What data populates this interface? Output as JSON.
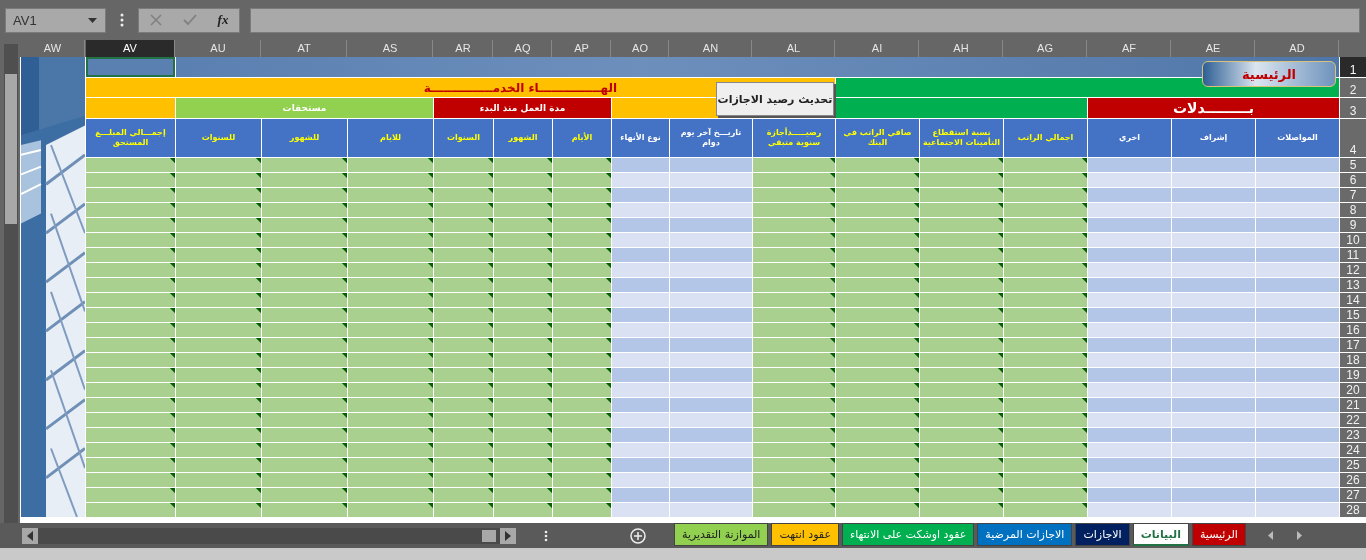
{
  "name_box": "AV1",
  "formula_bar": {
    "function_label": "fx"
  },
  "columns": [
    {
      "label": "AD",
      "selected": false
    },
    {
      "label": "AE",
      "selected": false
    },
    {
      "label": "AF",
      "selected": false
    },
    {
      "label": "AG",
      "selected": false
    },
    {
      "label": "AH",
      "selected": false
    },
    {
      "label": "AI",
      "selected": false
    },
    {
      "label": "AL",
      "selected": false
    },
    {
      "label": "AN",
      "selected": false
    },
    {
      "label": "AO",
      "selected": false
    },
    {
      "label": "AP",
      "selected": false
    },
    {
      "label": "AQ",
      "selected": false
    },
    {
      "label": "AR",
      "selected": false
    },
    {
      "label": "AS",
      "selected": false
    },
    {
      "label": "AT",
      "selected": false
    },
    {
      "label": "AU",
      "selected": false
    },
    {
      "label": "AV",
      "selected": true
    },
    {
      "label": "AW",
      "selected": false
    }
  ],
  "rows": [
    {
      "label": "1",
      "selected": true
    },
    {
      "label": "2",
      "selected": false
    },
    {
      "label": "3",
      "selected": false
    },
    {
      "label": "4",
      "selected": false
    },
    {
      "label": "5",
      "selected": false
    },
    {
      "label": "6",
      "selected": false
    },
    {
      "label": "7",
      "selected": false
    },
    {
      "label": "8",
      "selected": false
    },
    {
      "label": "9",
      "selected": false
    },
    {
      "label": "10",
      "selected": false
    },
    {
      "label": "11",
      "selected": false
    },
    {
      "label": "12",
      "selected": false
    },
    {
      "label": "13",
      "selected": false
    },
    {
      "label": "14",
      "selected": false
    },
    {
      "label": "15",
      "selected": false
    },
    {
      "label": "16",
      "selected": false
    },
    {
      "label": "17",
      "selected": false
    },
    {
      "label": "18",
      "selected": false
    },
    {
      "label": "19",
      "selected": false
    },
    {
      "label": "20",
      "selected": false
    },
    {
      "label": "21",
      "selected": false
    },
    {
      "label": "22",
      "selected": false
    },
    {
      "label": "23",
      "selected": false
    },
    {
      "label": "24",
      "selected": false
    },
    {
      "label": "25",
      "selected": false
    },
    {
      "label": "26",
      "selected": false
    },
    {
      "label": "27",
      "selected": false
    },
    {
      "label": "28",
      "selected": false
    }
  ],
  "title_row": [
    {
      "color": "#00b050"
    },
    {
      "label": "الهـــــــــــــــاء الخدمـــــــــــــــة",
      "color": "#ffc000"
    }
  ],
  "group_row": [
    {
      "label": "بـــــــــدلات",
      "color": "#c00000"
    },
    {
      "color": "#00b050"
    },
    {
      "color": "#ffc000"
    },
    {
      "label": "مدة العمل منذ البدء",
      "color": "#c00000"
    },
    {
      "label": "مستحقات",
      "color": "#92d050"
    },
    {
      "color": "#ffc000"
    }
  ],
  "headers": [
    {
      "label": "المواصلات",
      "kind": "entry"
    },
    {
      "label": "إشراف",
      "kind": "entry"
    },
    {
      "label": "اخري",
      "kind": "entry"
    },
    {
      "label": "اجمالي الراتب",
      "kind": "formula"
    },
    {
      "label": "نسبة استقطاع التأمينات الاجتماعية",
      "kind": "formula"
    },
    {
      "label": "صافي الراتب في البنك",
      "kind": "formula"
    },
    {
      "label": "رصيـــــدأجازة سنوية متبقي",
      "kind": "formula"
    },
    {
      "label": "تاريـــخ آخر يوم دوام",
      "kind": "entry"
    },
    {
      "label": "نوع الأنهاء",
      "kind": "entry"
    },
    {
      "label": "الأيام",
      "kind": "formula"
    },
    {
      "label": "الشهور",
      "kind": "formula"
    },
    {
      "label": "السنوات",
      "kind": "formula"
    },
    {
      "label": "للايام",
      "kind": "formula"
    },
    {
      "label": "للشهور",
      "kind": "formula"
    },
    {
      "label": "للسنوات",
      "kind": "formula"
    },
    {
      "label": "إجمـــالي المبلـــغ المستحق",
      "kind": "formula"
    }
  ],
  "update_button": "تحديث رصيد الاجازات",
  "home_button": "الرئيسية",
  "sheet_tabs": [
    {
      "label": "الرئيسية",
      "color": "#c00000",
      "selected": false
    },
    {
      "label": "البيانات",
      "color": "#ffffff",
      "selected": true
    },
    {
      "label": "الاجازات",
      "color": "#002060",
      "selected": false
    },
    {
      "label": "الاجازات المرضية",
      "color": "#0070c0",
      "selected": false
    },
    {
      "label": "عقود اوشكت على الانتهاء",
      "color": "#00b050",
      "selected": false
    },
    {
      "label": "عقود انتهت",
      "color": "#ffc000",
      "selected": false
    },
    {
      "label": "الموازنة التقديرية",
      "color": "#92d050",
      "selected": false
    }
  ]
}
